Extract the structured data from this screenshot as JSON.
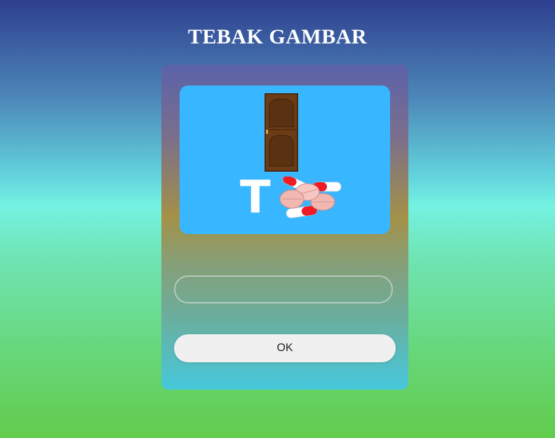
{
  "header": {
    "title": "TEBAK GAMBAR"
  },
  "puzzle": {
    "clue_letter": "T",
    "icons": [
      "door-icon",
      "pills-icon"
    ],
    "background_color": "#38b6ff"
  },
  "answer": {
    "value": "",
    "placeholder": ""
  },
  "actions": {
    "ok_label": "OK"
  }
}
